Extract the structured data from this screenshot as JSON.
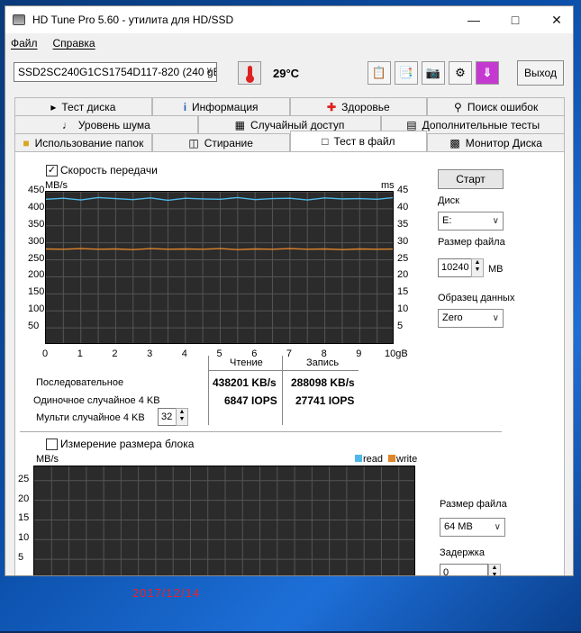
{
  "window": {
    "title": "HD Tune Pro 5.60 - утилита для HD/SSD"
  },
  "menu": [
    "Файл",
    "Справка"
  ],
  "toolbar": {
    "drive": "SSD2SC240G1CS1754D117-820 (240 gB)",
    "temperature": "29°C",
    "exit_label": "Выход"
  },
  "tabs": {
    "row1": [
      "Тест диска",
      "Информация",
      "Здоровье",
      "Поиск ошибок"
    ],
    "row2": [
      "Уровень шума",
      "Случайный доступ",
      "Дополнительные тесты"
    ],
    "row3": [
      "Использование папок",
      "Стирание",
      "Тест в файл",
      "Монитор Диска"
    ],
    "active": "Тест в файл"
  },
  "transfer": {
    "checkbox_label": "Скорость передачи",
    "checked": true,
    "left_unit": "MB/s",
    "right_unit": "ms"
  },
  "side": {
    "start_label": "Старт",
    "disk_label": "Диск",
    "disk_value": "E:",
    "file_size_label": "Размер файла",
    "file_size_value": "10240",
    "file_size_unit": "MB",
    "pattern_label": "Образец данных",
    "pattern_value": "Zero"
  },
  "results": {
    "read_header": "Чтение",
    "write_header": "Запись",
    "rows": [
      {
        "label": "Последовательное",
        "read": "438201 KB/s",
        "write": "288098 KB/s"
      },
      {
        "label": "Одиночное случайное 4 KB",
        "read": "6847 IOPS",
        "write": "27741 IOPS"
      },
      {
        "label": "Мульти случайное 4 KB",
        "read": "",
        "write": ""
      }
    ],
    "multi_value": "32"
  },
  "block": {
    "checkbox_label": "Измерение размера блока",
    "checked": false,
    "unit": "MB/s",
    "legend_read": "read",
    "legend_write": "write",
    "file_size_label": "Размер файла",
    "file_size_value": "64 MB",
    "delay_label": "Задержка",
    "delay_value": "0"
  },
  "colors": {
    "read": "#4fb8e8",
    "write": "#e0852c",
    "chart_bg": "#2b2b2b",
    "grid": "#555555"
  },
  "chart_data": [
    {
      "type": "line",
      "title": "",
      "xlabel": "",
      "ylabel": "MB/s",
      "y2label": "ms",
      "x_ticks": [
        "0",
        "1",
        "2",
        "3",
        "4",
        "5",
        "6",
        "7",
        "8",
        "9",
        "10gB"
      ],
      "y_ticks": [
        "450",
        "400",
        "350",
        "300",
        "250",
        "200",
        "150",
        "100",
        "50"
      ],
      "y2_ticks": [
        "45",
        "40",
        "35",
        "30",
        "25",
        "20",
        "15",
        "10",
        "5"
      ],
      "xlim": [
        0,
        10
      ],
      "ylim": [
        0,
        450
      ],
      "grid": true,
      "series": [
        {
          "values": [
            428,
            431,
            426,
            433,
            430,
            427,
            432,
            425,
            431,
            429,
            428,
            433,
            427,
            430,
            431,
            426,
            432,
            429,
            430,
            428,
            433
          ]
        },
        {
          "values": [
            282,
            281,
            283,
            281,
            282,
            280,
            283,
            281,
            282,
            281,
            283,
            280,
            282,
            281,
            283,
            281,
            282,
            280,
            282,
            281,
            282
          ]
        }
      ]
    },
    {
      "type": "bar",
      "title": "",
      "ylabel": "MB/s",
      "y_ticks": [
        "25",
        "20",
        "15",
        "10",
        "5"
      ],
      "ylim": [
        0,
        25
      ],
      "grid": true,
      "legend": "top-right",
      "series": [
        {
          "name": "read",
          "values": []
        },
        {
          "name": "write",
          "values": []
        }
      ]
    }
  ]
}
